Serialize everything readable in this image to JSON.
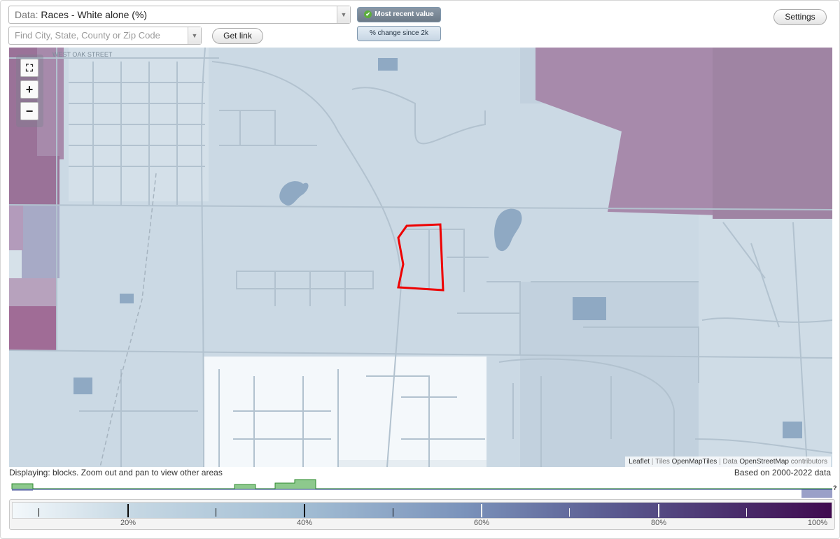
{
  "toolbar": {
    "data_prefix": "Data: ",
    "data_value": "Races - White alone (%)",
    "search_placeholder": "Find City, State, County or Zip Code",
    "get_link_label": "Get link",
    "settings_label": "Settings",
    "mode_most_recent_label": "Most recent value",
    "mode_change_label": "% change since 2k",
    "dropdown_icon": "triangle-down"
  },
  "map": {
    "street_label": "WEST OAK STREET",
    "zoom_controls": [
      "fullscreen",
      "+",
      "−"
    ],
    "colors": {
      "base": "#cbd9e4",
      "purple_block": "#a78aab",
      "purple_dark": "#9a7298",
      "white_block": "#f4f8fb",
      "highlight": "#ee0000",
      "water": "#8fa9c3"
    }
  },
  "attribution": {
    "leaflet": "Leaflet",
    "tiles_label": "Tiles",
    "tiles_source": "OpenMapTiles",
    "data_label": "Data",
    "data_source": "OpenStreetMap",
    "contributors": "contributors"
  },
  "status": {
    "displaying": "Displaying: blocks. Zoom out and pan to view other areas",
    "based_on": "Based on 2000-2022 data",
    "histogram_unknown": "?"
  },
  "legend": {
    "labels": [
      "20%",
      "40%",
      "60%",
      "80%",
      "100%"
    ],
    "colors": [
      "#f3f8fb",
      "#a3bed4",
      "#7b93bb",
      "#5c5e93",
      "#400a4f"
    ]
  }
}
